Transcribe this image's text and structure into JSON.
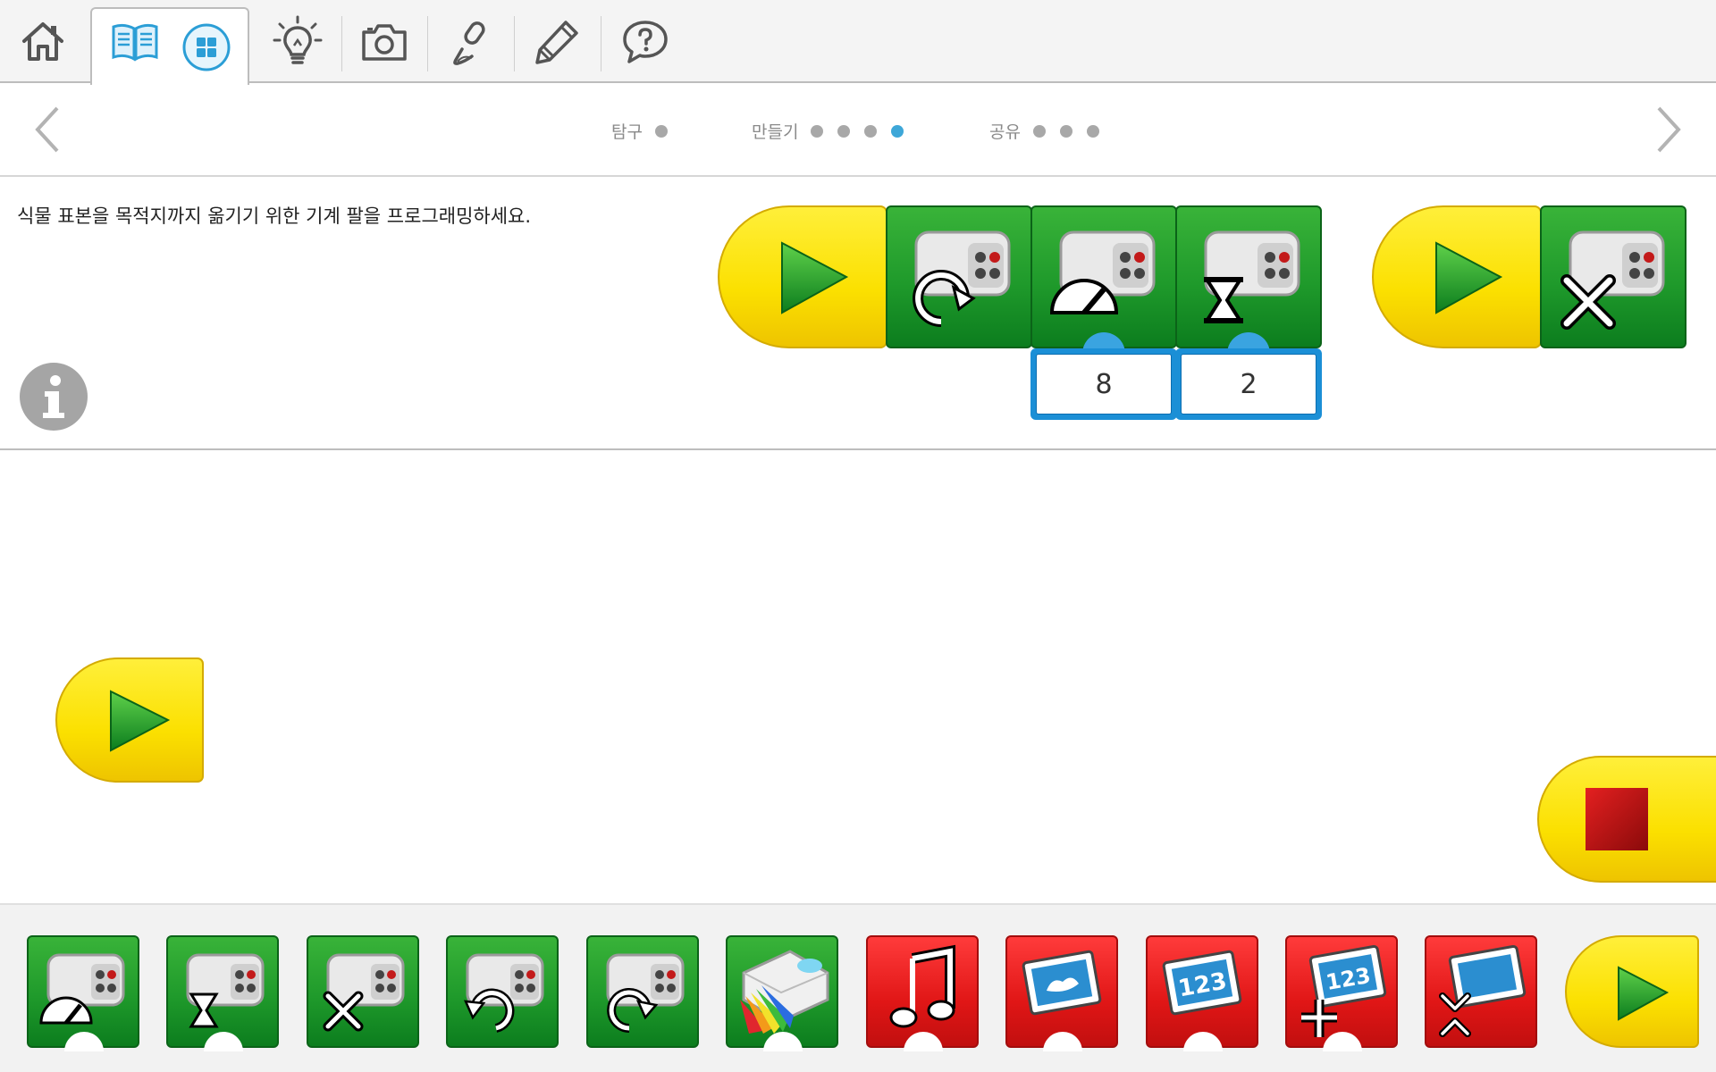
{
  "toolbar": {
    "items": [
      "home-icon",
      "book-icon",
      "grid-icon",
      "lightbulb-icon",
      "camera-icon",
      "microphone-pen-icon",
      "pencil-icon",
      "help-icon"
    ]
  },
  "steps": {
    "groups": [
      {
        "label": "탐구",
        "dots": 1,
        "active": -1
      },
      {
        "label": "만들기",
        "dots": 4,
        "active": 3
      },
      {
        "label": "공유",
        "dots": 3,
        "active": -1
      }
    ]
  },
  "instruction": {
    "text": "식물 표본을 목적지까지 옮기기 위한 기계 팔을 프로그래밍하세요."
  },
  "program": {
    "speed_value": "8",
    "wait_value": "2"
  },
  "palette": {
    "items": [
      {
        "icon": "motor-power-icon",
        "color": "green"
      },
      {
        "icon": "motor-wait-icon",
        "color": "green"
      },
      {
        "icon": "motor-stop-icon",
        "color": "green"
      },
      {
        "icon": "motor-counterclockwise-icon",
        "color": "green"
      },
      {
        "icon": "motor-clockwise-icon",
        "color": "green"
      },
      {
        "icon": "hub-light-icon",
        "color": "green"
      },
      {
        "icon": "sound-icon",
        "color": "red"
      },
      {
        "icon": "display-image-icon",
        "color": "red"
      },
      {
        "icon": "display-number-icon",
        "color": "red"
      },
      {
        "icon": "display-add-number-icon",
        "color": "red"
      },
      {
        "icon": "display-shrink-icon",
        "color": "red"
      },
      {
        "icon": "start-block-icon",
        "color": "yellow"
      }
    ]
  },
  "colors": {
    "accent": "#3ea7d8",
    "green_block": "#1f9a2b",
    "red_block": "#e01616",
    "yellow_block": "#fbe000",
    "input_blue": "#1b8fd6"
  }
}
